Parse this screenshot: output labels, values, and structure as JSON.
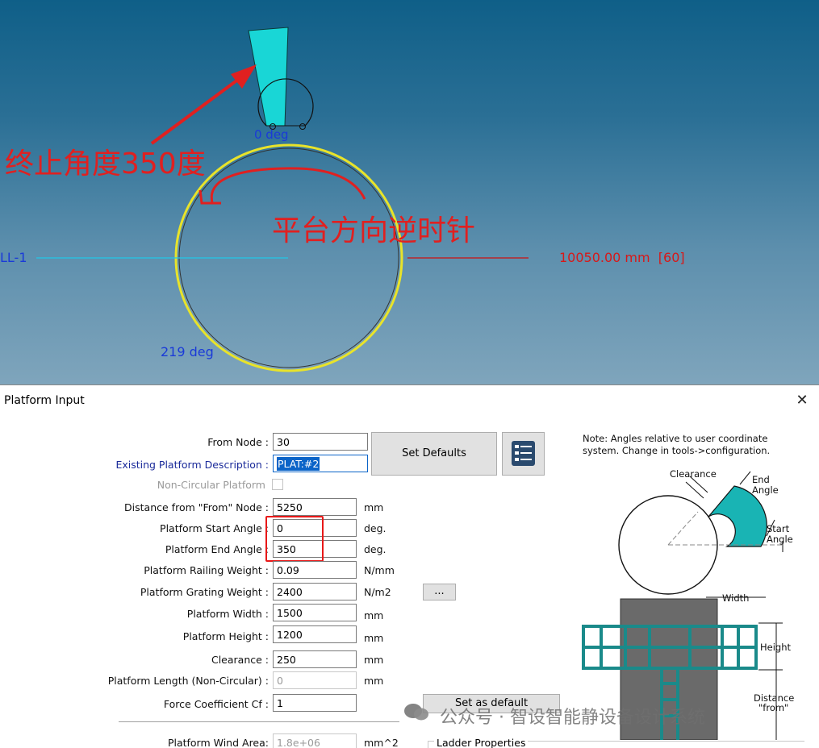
{
  "viewport": {
    "start_label": "0 deg",
    "rim_label": "219 deg",
    "dim_label": "10050.00 mm  [60]",
    "line_label": "LL-1",
    "annotation_end": "终止角度350度",
    "annotation_dir": "平台方向逆时针"
  },
  "dialog": {
    "title": "Platform Input",
    "close_glyph": "✕",
    "fields": {
      "from_node": {
        "label": "From Node :",
        "value": "30"
      },
      "existing_desc": {
        "label": "Existing Platform Description :",
        "value": "PLAT:#2"
      },
      "non_circular": {
        "label": "Non-Circular Platform"
      },
      "distance": {
        "label": "Distance from \"From\" Node :",
        "value": "5250",
        "unit": "mm"
      },
      "start_angle": {
        "label": "Platform Start Angle :",
        "value": "0",
        "unit": "deg."
      },
      "end_angle": {
        "label": "Platform End Angle :",
        "value": "350",
        "unit": "deg."
      },
      "railing": {
        "label": "Platform Railing Weight :",
        "value": "0.09",
        "unit": "N/mm"
      },
      "grating": {
        "label": "Platform Grating Weight :",
        "value": "2400",
        "unit": "N/m2"
      },
      "width": {
        "label": "Platform Width :",
        "value": "1500",
        "unit": "mm"
      },
      "height": {
        "label": "Platform Height :",
        "value": "1200",
        "unit": "mm"
      },
      "clearance": {
        "label": "Clearance :",
        "value": "250",
        "unit": "mm"
      },
      "length": {
        "label": "Platform Length (Non-Circular) :",
        "value": "0",
        "unit": "mm"
      },
      "force": {
        "label": "Force Coefficient Cf :",
        "value": "1"
      },
      "wind_area": {
        "label": "Platform Wind Area:",
        "value": "1.8e+06",
        "unit": "mm^2"
      }
    },
    "buttons": {
      "set_defaults": "Set Defaults",
      "ellipsis": "...",
      "set_as_default": "Set as default"
    },
    "note_line1": "Note: Angles relative to user coordinate",
    "note_line2": "system. Change in tools->configuration.",
    "diagram": {
      "clearance": "Clearance",
      "end_angle_1": "End",
      "end_angle_2": "Angle",
      "start_angle_1": "Start",
      "start_angle_2": "Angle",
      "width": "Width",
      "height": "Height",
      "distance_1": "Distance",
      "distance_2": "\"from\""
    },
    "ladder_props": "Ladder Properties",
    "watermark": "公众号 · 智设智能静设备设计系统",
    "colors": {
      "platform": "#19b4b4",
      "annotation": "#e02020",
      "highlight": "#e81818"
    }
  }
}
